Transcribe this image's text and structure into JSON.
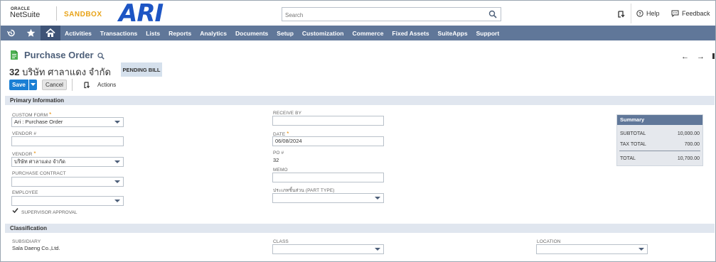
{
  "header": {
    "oracle_label": "ORACLE",
    "netsuite_label": "NetSuite",
    "sandbox_label": "SANDBOX",
    "brand_logo": "ARI",
    "search_placeholder": "Search",
    "help_label": "Help",
    "feedback_label": "Feedback"
  },
  "nav": {
    "items": [
      "Activities",
      "Transactions",
      "Lists",
      "Reports",
      "Analytics",
      "Documents",
      "Setup",
      "Customization",
      "Commerce",
      "Fixed Assets",
      "SuiteApps",
      "Support"
    ]
  },
  "page": {
    "title": "Purchase Order",
    "record_number": "32",
    "record_vendor": "บริษัท ศาลาแดง จำกัด",
    "status": "PENDING BILL",
    "prev_arrow": "←",
    "next_arrow": "→"
  },
  "buttons": {
    "save": "Save",
    "cancel": "Cancel",
    "actions": "Actions"
  },
  "primary": {
    "section_title": "Primary Information",
    "custom_form_label": "CUSTOM FORM",
    "custom_form_value": "Ari : Purchase Order",
    "vendor_no_label": "VENDOR #",
    "vendor_no_value": "",
    "vendor_label": "VENDOR",
    "vendor_value": "บริษัท ศาลาแดง จำกัด",
    "purchase_contract_label": "PURCHASE CONTRACT",
    "purchase_contract_value": "",
    "employee_label": "EMPLOYEE",
    "employee_value": "",
    "supervisor_approval_label": "SUPERVISOR APPROVAL",
    "supervisor_approval_checked": true,
    "receive_by_label": "RECEIVE BY",
    "receive_by_value": "",
    "date_label": "DATE",
    "date_value": "06/08/2024",
    "po_label": "PO #",
    "po_value": "32",
    "memo_label": "MEMO",
    "memo_value": "",
    "part_type_label": "ประเภทชิ้นส่วน (PART TYPE)",
    "part_type_value": ""
  },
  "summary": {
    "title": "Summary",
    "subtotal_label": "SUBTOTAL",
    "subtotal_value": "10,000.00",
    "tax_total_label": "TAX TOTAL",
    "tax_total_value": "700.00",
    "total_label": "TOTAL",
    "total_value": "10,700.00"
  },
  "classification": {
    "section_title": "Classification",
    "subsidiary_label": "SUBSIDIARY",
    "subsidiary_value": "Sala Daeng Co.,Ltd.",
    "class_label": "CLASS",
    "class_value": "",
    "location_label": "LOCATION",
    "location_value": ""
  },
  "colors": {
    "nav_bg": "#607799",
    "nav_home_bg": "#3f5477",
    "primary_button": "#1a7fd4",
    "section_bg": "#e0e6ef",
    "sandbox_text": "#e8a317",
    "brand_blue": "#1d55c4",
    "required_star": "#e68a00"
  }
}
